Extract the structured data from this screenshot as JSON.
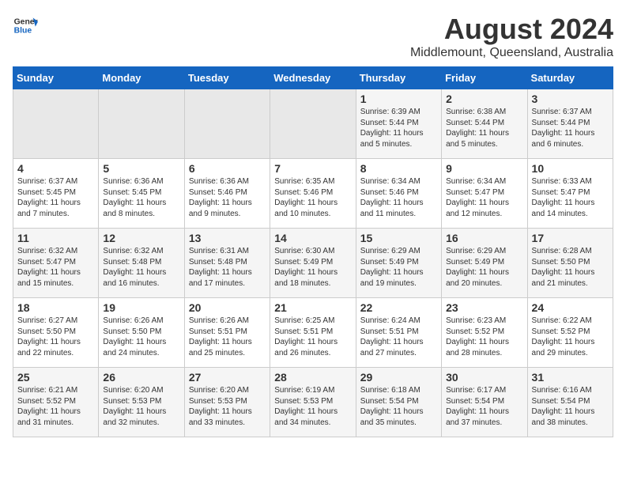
{
  "header": {
    "logo_general": "General",
    "logo_blue": "Blue",
    "month": "August 2024",
    "location": "Middlemount, Queensland, Australia"
  },
  "weekdays": [
    "Sunday",
    "Monday",
    "Tuesday",
    "Wednesday",
    "Thursday",
    "Friday",
    "Saturday"
  ],
  "weeks": [
    [
      {
        "day": "",
        "info": ""
      },
      {
        "day": "",
        "info": ""
      },
      {
        "day": "",
        "info": ""
      },
      {
        "day": "",
        "info": ""
      },
      {
        "day": "1",
        "info": "Sunrise: 6:39 AM\nSunset: 5:44 PM\nDaylight: 11 hours and 5 minutes."
      },
      {
        "day": "2",
        "info": "Sunrise: 6:38 AM\nSunset: 5:44 PM\nDaylight: 11 hours and 5 minutes."
      },
      {
        "day": "3",
        "info": "Sunrise: 6:37 AM\nSunset: 5:44 PM\nDaylight: 11 hours and 6 minutes."
      }
    ],
    [
      {
        "day": "4",
        "info": "Sunrise: 6:37 AM\nSunset: 5:45 PM\nDaylight: 11 hours and 7 minutes."
      },
      {
        "day": "5",
        "info": "Sunrise: 6:36 AM\nSunset: 5:45 PM\nDaylight: 11 hours and 8 minutes."
      },
      {
        "day": "6",
        "info": "Sunrise: 6:36 AM\nSunset: 5:46 PM\nDaylight: 11 hours and 9 minutes."
      },
      {
        "day": "7",
        "info": "Sunrise: 6:35 AM\nSunset: 5:46 PM\nDaylight: 11 hours and 10 minutes."
      },
      {
        "day": "8",
        "info": "Sunrise: 6:34 AM\nSunset: 5:46 PM\nDaylight: 11 hours and 11 minutes."
      },
      {
        "day": "9",
        "info": "Sunrise: 6:34 AM\nSunset: 5:47 PM\nDaylight: 11 hours and 12 minutes."
      },
      {
        "day": "10",
        "info": "Sunrise: 6:33 AM\nSunset: 5:47 PM\nDaylight: 11 hours and 14 minutes."
      }
    ],
    [
      {
        "day": "11",
        "info": "Sunrise: 6:32 AM\nSunset: 5:47 PM\nDaylight: 11 hours and 15 minutes."
      },
      {
        "day": "12",
        "info": "Sunrise: 6:32 AM\nSunset: 5:48 PM\nDaylight: 11 hours and 16 minutes."
      },
      {
        "day": "13",
        "info": "Sunrise: 6:31 AM\nSunset: 5:48 PM\nDaylight: 11 hours and 17 minutes."
      },
      {
        "day": "14",
        "info": "Sunrise: 6:30 AM\nSunset: 5:49 PM\nDaylight: 11 hours and 18 minutes."
      },
      {
        "day": "15",
        "info": "Sunrise: 6:29 AM\nSunset: 5:49 PM\nDaylight: 11 hours and 19 minutes."
      },
      {
        "day": "16",
        "info": "Sunrise: 6:29 AM\nSunset: 5:49 PM\nDaylight: 11 hours and 20 minutes."
      },
      {
        "day": "17",
        "info": "Sunrise: 6:28 AM\nSunset: 5:50 PM\nDaylight: 11 hours and 21 minutes."
      }
    ],
    [
      {
        "day": "18",
        "info": "Sunrise: 6:27 AM\nSunset: 5:50 PM\nDaylight: 11 hours and 22 minutes."
      },
      {
        "day": "19",
        "info": "Sunrise: 6:26 AM\nSunset: 5:50 PM\nDaylight: 11 hours and 24 minutes."
      },
      {
        "day": "20",
        "info": "Sunrise: 6:26 AM\nSunset: 5:51 PM\nDaylight: 11 hours and 25 minutes."
      },
      {
        "day": "21",
        "info": "Sunrise: 6:25 AM\nSunset: 5:51 PM\nDaylight: 11 hours and 26 minutes."
      },
      {
        "day": "22",
        "info": "Sunrise: 6:24 AM\nSunset: 5:51 PM\nDaylight: 11 hours and 27 minutes."
      },
      {
        "day": "23",
        "info": "Sunrise: 6:23 AM\nSunset: 5:52 PM\nDaylight: 11 hours and 28 minutes."
      },
      {
        "day": "24",
        "info": "Sunrise: 6:22 AM\nSunset: 5:52 PM\nDaylight: 11 hours and 29 minutes."
      }
    ],
    [
      {
        "day": "25",
        "info": "Sunrise: 6:21 AM\nSunset: 5:52 PM\nDaylight: 11 hours and 31 minutes."
      },
      {
        "day": "26",
        "info": "Sunrise: 6:20 AM\nSunset: 5:53 PM\nDaylight: 11 hours and 32 minutes."
      },
      {
        "day": "27",
        "info": "Sunrise: 6:20 AM\nSunset: 5:53 PM\nDaylight: 11 hours and 33 minutes."
      },
      {
        "day": "28",
        "info": "Sunrise: 6:19 AM\nSunset: 5:53 PM\nDaylight: 11 hours and 34 minutes."
      },
      {
        "day": "29",
        "info": "Sunrise: 6:18 AM\nSunset: 5:54 PM\nDaylight: 11 hours and 35 minutes."
      },
      {
        "day": "30",
        "info": "Sunrise: 6:17 AM\nSunset: 5:54 PM\nDaylight: 11 hours and 37 minutes."
      },
      {
        "day": "31",
        "info": "Sunrise: 6:16 AM\nSunset: 5:54 PM\nDaylight: 11 hours and 38 minutes."
      }
    ]
  ]
}
